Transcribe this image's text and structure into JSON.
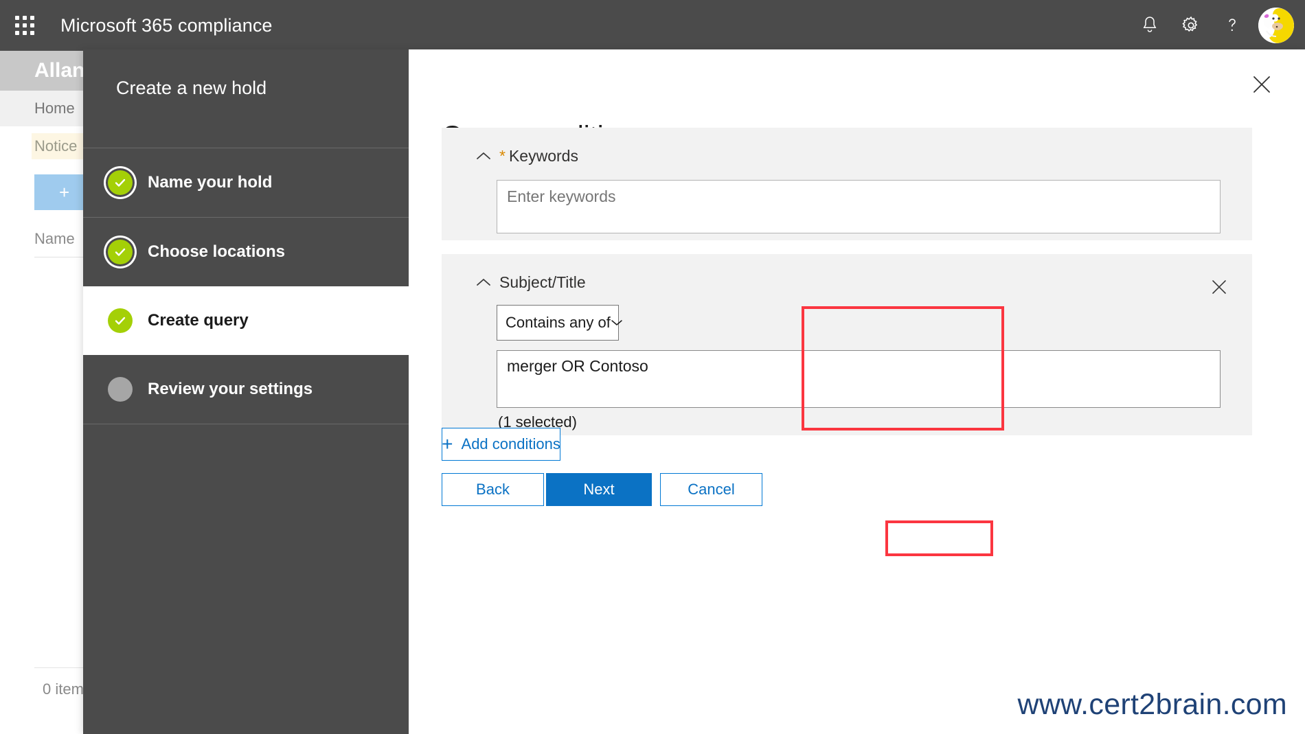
{
  "suite": {
    "title": "Microsoft 365 compliance",
    "waffle_icon": "waffle-grid-icon",
    "notifications_icon": "bell-icon",
    "settings_icon": "gear-icon",
    "help_icon": "question-mark-icon",
    "avatar_icon": "user-avatar"
  },
  "background": {
    "page_title": "Allan",
    "breadcrumb": "Home",
    "notice": "Notice",
    "new_button": "+",
    "column_header": "Name",
    "item_count": "0 item"
  },
  "panel": {
    "nav_title": "Create a new hold",
    "close_icon": "close-icon",
    "steps": [
      {
        "label": "Name your hold",
        "state": "done"
      },
      {
        "label": "Choose locations",
        "state": "done"
      },
      {
        "label": "Create query",
        "state": "current"
      },
      {
        "label": "Review your settings",
        "state": "todo"
      }
    ],
    "heading": "Query conditions",
    "conditions": [
      {
        "name": "keywords",
        "label": "Keywords",
        "required": true,
        "required_marker": "*",
        "collapse_icon": "chevron-up-icon",
        "input_placeholder": "Enter keywords",
        "input_value": ""
      },
      {
        "name": "subject-title",
        "label": "Subject/Title",
        "required": false,
        "collapse_icon": "chevron-up-icon",
        "remove_icon": "close-icon",
        "operator": "Contains any of",
        "operator_chevron_icon": "chevron-down-icon",
        "value": "merger OR Contoso",
        "selected_note": "(1 selected)"
      }
    ],
    "add_conditions": {
      "plus": "+",
      "label": "Add conditions",
      "icon": "plus-icon"
    },
    "actions": {
      "back": "Back",
      "next": "Next",
      "cancel": "Cancel"
    }
  },
  "annotations": {
    "highlight_color": "#fb3640",
    "highlighted": [
      "subject-title-condition",
      "next-button"
    ]
  },
  "watermark": "www.cert2brain.com",
  "colors": {
    "suite_bar": "#4b4b4b",
    "nav_panel": "#4b4b4b",
    "accent_blue": "#0b72c4",
    "step_done_green": "#a4d007",
    "step_todo_gray": "#a6a6a6",
    "required_star": "#d98800",
    "card_bg": "#f2f2f2",
    "watermark": "#1f4276"
  }
}
